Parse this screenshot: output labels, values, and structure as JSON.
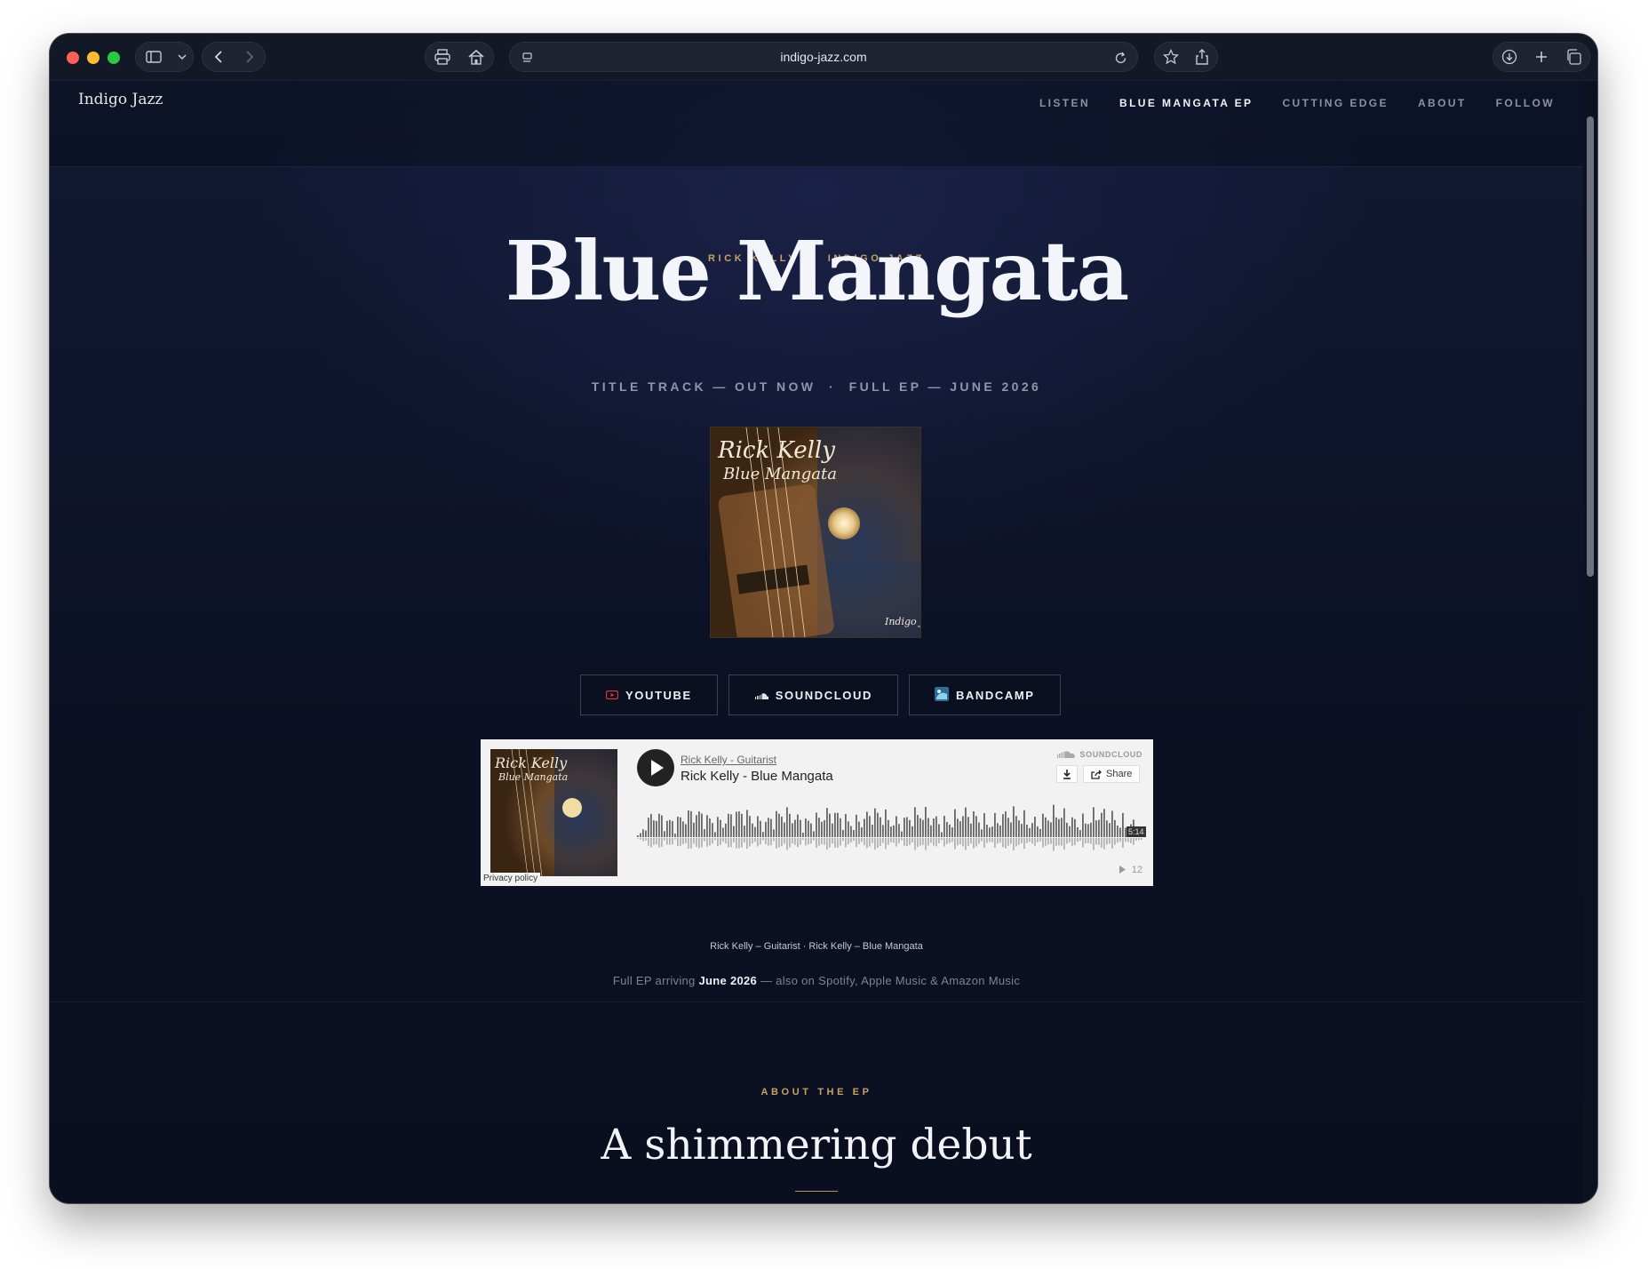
{
  "browser": {
    "url": "indigo-jazz.com"
  },
  "site": {
    "brand": "Indigo Jazz",
    "nav": [
      {
        "label": "LISTEN",
        "active": false
      },
      {
        "label": "BLUE MANGATA EP",
        "active": true
      },
      {
        "label": "CUTTING EDGE",
        "active": false
      },
      {
        "label": "ABOUT",
        "active": false
      },
      {
        "label": "FOLLOW",
        "active": false
      }
    ]
  },
  "hero": {
    "eyebrow": "RICK KELLY  ·  INDIGO JAZZ",
    "title": "Blue Mangata",
    "subline": "TITLE TRACK — OUT NOW  ·  FULL EP — JUNE 2026",
    "cover_text": "Rick Kelly",
    "cover_subtext": "Blue Mangata",
    "cover_logo": "Indigo Jazz",
    "buttons": [
      {
        "label": "YOUTUBE",
        "icon": "youtube-icon",
        "color": "#e23a2e"
      },
      {
        "label": "SOUNDCLOUD",
        "icon": "soundcloud-icon",
        "color": "#ffffff"
      },
      {
        "label": "BANDCAMP",
        "icon": "bandcamp-icon",
        "color": "#5fa8c8"
      }
    ]
  },
  "player": {
    "user": "Rick Kelly - Guitarist",
    "track": "Rick Kelly - Blue Mangata",
    "brand": "SOUNDCLOUD",
    "share_label": "Share",
    "duration": "5:14",
    "plays": "12",
    "privacy": "Privacy policy"
  },
  "caption": "Rick Kelly – Guitarist · Rick Kelly – Blue Mangata",
  "ep_note": {
    "before": "Full EP arriving ",
    "highlight": "June 2026",
    "after": " — also on Spotify, Apple Music & Amazon Music"
  },
  "about": {
    "eyebrow": "ABOUT THE EP",
    "title": "A shimmering debut"
  },
  "colors": {
    "accent_gold": "#c8a25f",
    "background": "#0c1224"
  }
}
